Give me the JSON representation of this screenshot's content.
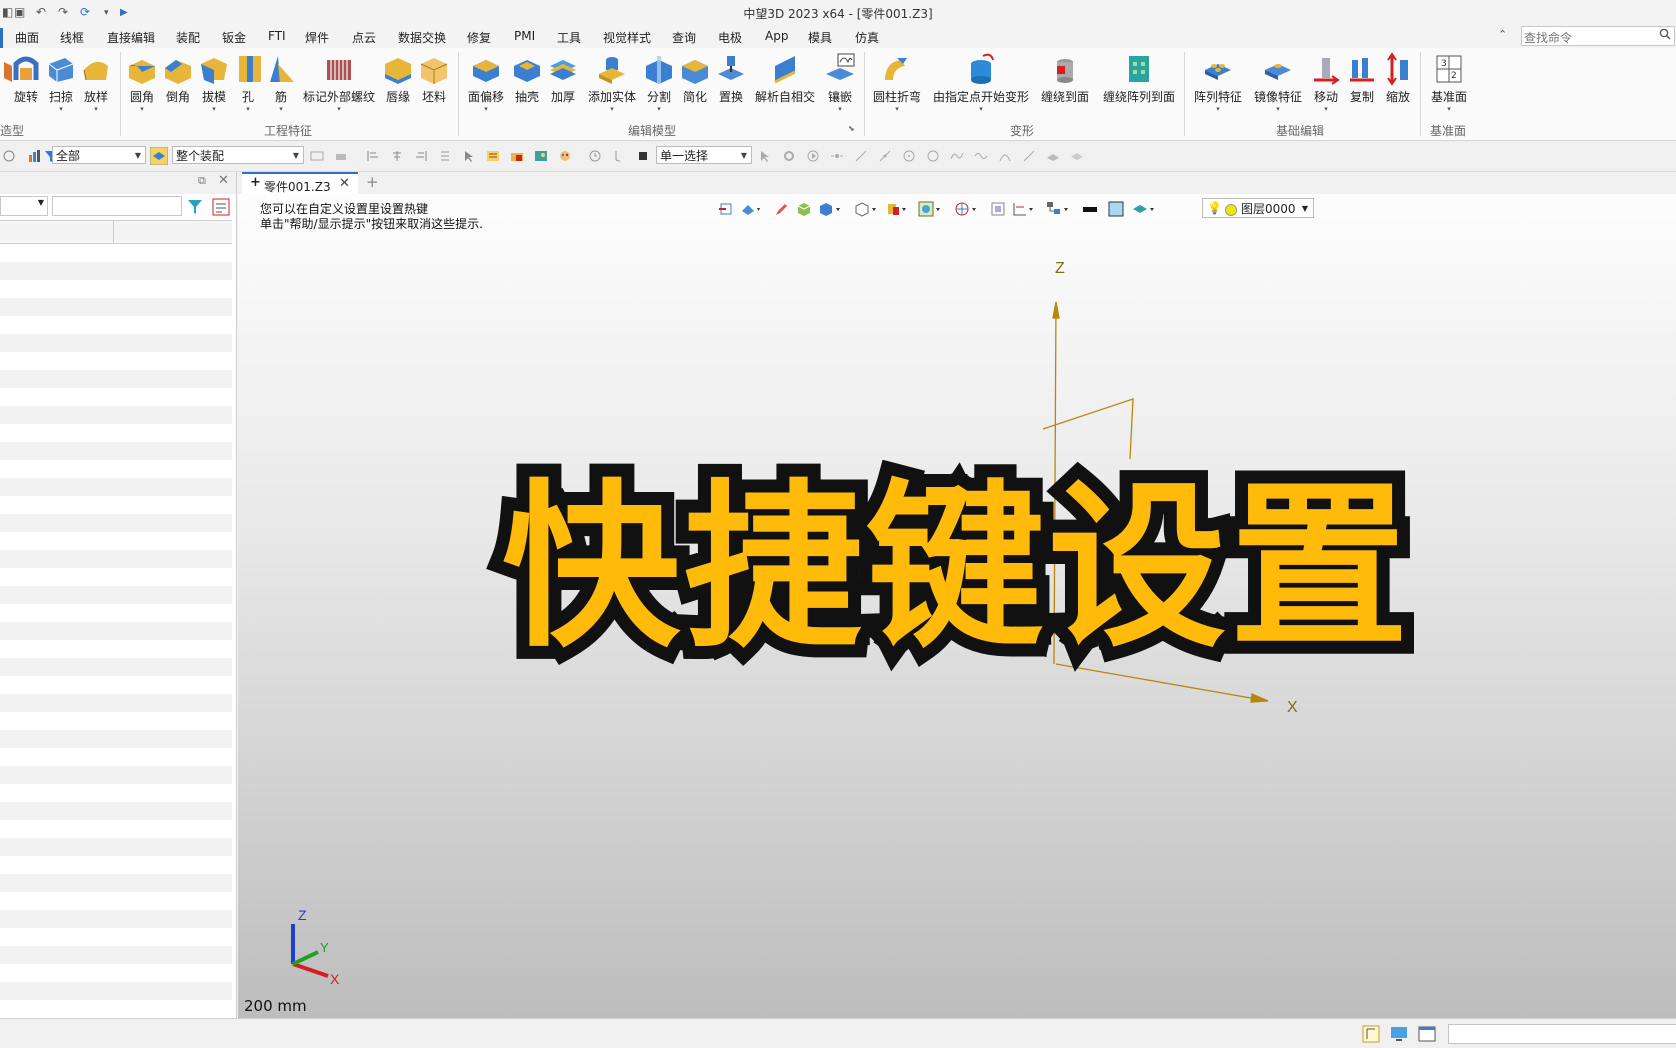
{
  "window": {
    "title": "中望3D 2023 x64 - [零件001.Z3]"
  },
  "menu": [
    "曲面",
    "线框",
    "直接编辑",
    "装配",
    "钣金",
    "FTI",
    "焊件",
    "点云",
    "数据交换",
    "修复",
    "PMI",
    "工具",
    "视觉样式",
    "查询",
    "电极",
    "App",
    "模具",
    "仿真"
  ],
  "search": {
    "placeholder": "查找命令"
  },
  "ribbon": {
    "groups": [
      "造型",
      "工程特征",
      "编辑模型",
      "变形",
      "基础编辑",
      "基准面"
    ],
    "buttons": [
      "旋转",
      "扫掠",
      "放样",
      "圆角",
      "倒角",
      "拔模",
      "孔",
      "筋",
      "标记外部螺纹",
      "唇缘",
      "坯料",
      "面偏移",
      "抽壳",
      "加厚",
      "添加实体",
      "分割",
      "简化",
      "置换",
      "解析自相交",
      "镶嵌",
      "圆柱折弯",
      "由指定点开始变形",
      "缠绕到面",
      "缠绕阵列到面",
      "阵列特征",
      "镜像特征",
      "移动",
      "复制",
      "缩放",
      "基准面"
    ]
  },
  "toolbar2": {
    "filter_value": "全部",
    "assembly_value": "整个装配",
    "select_value": "单一选择"
  },
  "document_tab": {
    "label": "零件001.Z3"
  },
  "viewport": {
    "hint_line1": "您可以在自定义设置里设置热键",
    "hint_line2": "单击\"帮助/显示提示\"按钮来取消这些提示.",
    "layer": "图层0000",
    "scale": "200 mm",
    "axis_z": "Z",
    "axis_x": "X",
    "triad_z": "Z",
    "triad_y": "Y",
    "triad_x": "X"
  },
  "overlay": {
    "title": "快捷键设置"
  },
  "colors": {
    "overlay_fill": "#ffba0a",
    "overlay_stroke": "#111111",
    "accent": "#2e6fc7",
    "axis": "#b8860b"
  }
}
